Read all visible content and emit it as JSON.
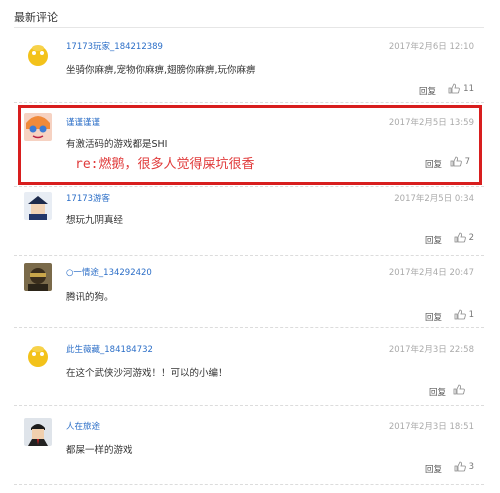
{
  "section": {
    "title": "最新评论"
  },
  "comments": [
    {
      "user": "17173玩家_184212389",
      "time": "2017年2月6日 12:10",
      "text": "坐骑你麻痹,宠物你麻痹,翅膀你麻痹,玩你麻痹",
      "reply": "回复",
      "likes": "11"
    },
    {
      "user": "谨谨谨谨",
      "time": "2017年2月5日 13:59",
      "text": "有激活码的游戏都是SHI",
      "reply": "回复",
      "likes": "7"
    },
    {
      "user": "17173游客",
      "time": "2017年2月5日 0:34",
      "text": "想玩九阴真经",
      "reply": "回复",
      "likes": "2"
    },
    {
      "user": "○一情途_134292420",
      "time": "2017年2月4日 20:47",
      "text": "腾讯的狗。",
      "reply": "回复",
      "likes": "1"
    },
    {
      "user": "此生薇藏_184184732",
      "time": "2017年2月3日 22:58",
      "text": "在这个武侠沙河游戏！！可以的小编！",
      "reply": "回复",
      "likes": ""
    },
    {
      "user": "人在旅途",
      "time": "2017年2月3日 18:51",
      "text": "都屎一样的游戏",
      "reply": "回复",
      "likes": "3"
    }
  ],
  "annotation": {
    "text": "re:燃鹅，很多人觉得屎坑很香"
  },
  "colors": {
    "highlight_border": "#d81e1e",
    "username": "#2b6ec7",
    "annotation": "#e03a3a"
  }
}
